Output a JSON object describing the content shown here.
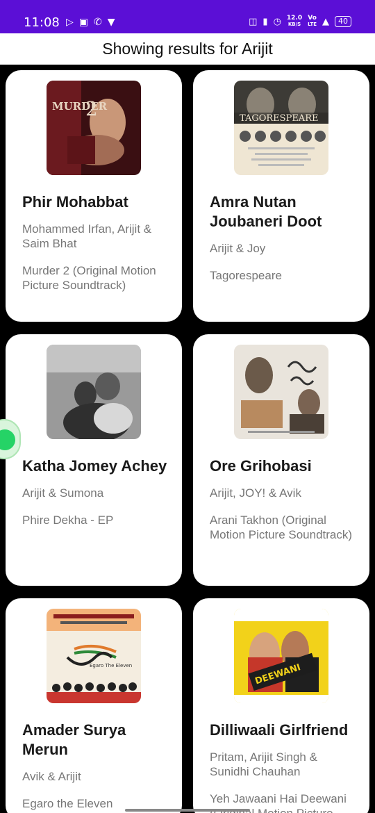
{
  "status_bar": {
    "time": "11:08",
    "speed": "12.0",
    "speed_unit": "KB/S",
    "net_top": "Vo",
    "net_bottom": "LTE",
    "battery": "40",
    "icons": [
      "video-icon",
      "calendar-icon",
      "missed-call-icon",
      "app-icon",
      "headset-icon",
      "vibrate-icon",
      "alarm-icon",
      "signal-icon"
    ]
  },
  "header": {
    "title": "Showing results for Arijit"
  },
  "results": [
    {
      "title": "Phir Mohabbat",
      "artist": "Mohammed Irfan, Arijit & Saim Bhat",
      "album": "Murder 2 (Original Motion Picture Soundtrack)",
      "art_text": "MURDER 2"
    },
    {
      "title": "Amra Nutan Joubaneri Doot",
      "artist": "Arijit & Joy",
      "album": "Tagorespeare",
      "art_text": "TAGORESPEARE"
    },
    {
      "title": "Katha Jomey Achey",
      "artist": "Arijit & Sumona",
      "album": "Phire Dekha - EP",
      "art_text": ""
    },
    {
      "title": "Ore Grihobasi",
      "artist": "Arijit, JOY! & Avik",
      "album": "Arani Takhon (Original Motion Picture Soundtrack)",
      "art_text": ""
    },
    {
      "title": "Amader Surya Merun",
      "artist": "Avik & Arijit",
      "album": "Egaro the Eleven",
      "art_text": "Egaro The Eleven"
    },
    {
      "title": "Dilliwaali Girlfriend",
      "artist": "Pritam, Arijit Singh & Sunidhi Chauhan",
      "album": "Yeh Jawaani Hai Deewani (Original Motion Picture Soundtrack)",
      "art_text": "DEEWANI"
    }
  ]
}
